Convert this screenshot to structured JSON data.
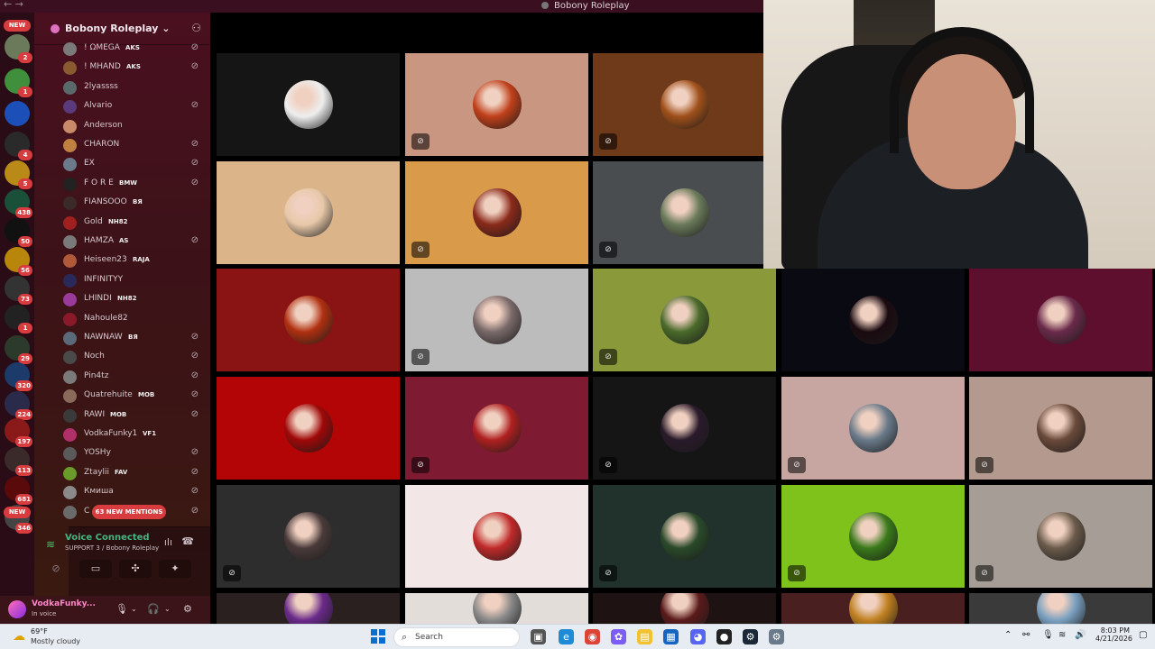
{
  "window": {
    "title": "Bobony Roleplay",
    "nav_label": "← →"
  },
  "rail": {
    "new_label_top": "NEW",
    "new_label_bottom": "NEW",
    "servers": [
      {
        "color": "#6a7a5a",
        "badge": "2"
      },
      {
        "color": "#3f8f3c",
        "badge": "1"
      },
      {
        "color": "#1d4fb8",
        "badge": ""
      },
      {
        "color": "#2a2a2a",
        "badge": "4"
      },
      {
        "color": "#b98a18",
        "badge": "5"
      },
      {
        "color": "#1a4f3a",
        "badge": "438"
      },
      {
        "color": "#111111",
        "badge": "50"
      },
      {
        "color": "#b8860b",
        "badge": "56"
      },
      {
        "color": "#333333",
        "badge": "73"
      },
      {
        "color": "#222222",
        "badge": "1"
      },
      {
        "color": "#2c3a2c",
        "badge": "29"
      },
      {
        "color": "#1c3a6a",
        "badge": "320"
      },
      {
        "color": "#2a2a4a",
        "badge": "224"
      },
      {
        "color": "#8a1a1a",
        "badge": "197"
      },
      {
        "color": "#3a2a2a",
        "badge": "113"
      },
      {
        "color": "#5a0a0a",
        "badge": "681"
      },
      {
        "color": "#444444",
        "badge": "346"
      }
    ]
  },
  "sidebar": {
    "server_name": "Bobony Roleplay",
    "server_caret": "⌄",
    "invite_icon": "add-person-icon",
    "members": [
      {
        "name": "! ΩMEGA",
        "tag": "AKS",
        "color": "#7a7a7a",
        "muted": true
      },
      {
        "name": "! MHAND",
        "tag": "AKS",
        "color": "#8a5a30",
        "muted": true
      },
      {
        "name": "2lyassss",
        "tag": "",
        "color": "#5a6a6a",
        "muted": false
      },
      {
        "name": "Alvario",
        "tag": "",
        "color": "#5a3a7a",
        "muted": true
      },
      {
        "name": "Anderson",
        "tag": "",
        "color": "#c98a6a",
        "muted": false
      },
      {
        "name": "CHARON",
        "tag": "",
        "color": "#c08040",
        "muted": true
      },
      {
        "name": "EX",
        "tag": "",
        "color": "#6a7a8a",
        "muted": true
      },
      {
        "name": "F O R E",
        "tag": "BMW",
        "color": "#222222",
        "muted": true
      },
      {
        "name": "FIANSOOO",
        "tag": "BЯ",
        "color": "#3a2a2a",
        "muted": false
      },
      {
        "name": "Gold",
        "tag": "NH82",
        "color": "#a02020",
        "muted": false
      },
      {
        "name": "HAMZA",
        "tag": "AS",
        "color": "#7a7a7a",
        "muted": true
      },
      {
        "name": "Heiseen23",
        "tag": "RAJA",
        "color": "#b05a3a",
        "muted": false
      },
      {
        "name": "INFINITYY",
        "tag": "",
        "color": "#2a2a5a",
        "muted": false
      },
      {
        "name": "LHINDI",
        "tag": "NH82",
        "color": "#9a3a9a",
        "muted": false
      },
      {
        "name": "Nahoule82",
        "tag": "",
        "color": "#8a1a2a",
        "muted": false
      },
      {
        "name": "NAWNAW",
        "tag": "BЯ",
        "color": "#5a6a7a",
        "muted": true
      },
      {
        "name": "Noch",
        "tag": "",
        "color": "#4a4a4a",
        "muted": true
      },
      {
        "name": "Pin4tz",
        "tag": "",
        "color": "#7a7a7a",
        "muted": true
      },
      {
        "name": "Quatrehuite",
        "tag": "MOB",
        "color": "#8a6a5a",
        "muted": true
      },
      {
        "name": "RAWI",
        "tag": "MOB",
        "color": "#3a3a3a",
        "muted": true
      },
      {
        "name": "VodkaFunky1",
        "tag": "VF1",
        "color": "#b0306a",
        "muted": false
      },
      {
        "name": "YOSHy",
        "tag": "",
        "color": "#5a5a5a",
        "muted": true
      },
      {
        "name": "Ztaylii",
        "tag": "FAV",
        "color": "#6a9a2a",
        "muted": true
      },
      {
        "name": "Кмиша",
        "tag": "",
        "color": "#8a8a8a",
        "muted": true
      },
      {
        "name": "C",
        "tag": "",
        "color": "#6a6a6a",
        "muted": true
      }
    ],
    "mentions_label": "63 NEW MENTIONS",
    "voice": {
      "status": "Voice Connected",
      "channel": "SUPPORT 3 / Bobony Roleplay"
    },
    "user": {
      "name": "VodkaFunky...",
      "status": "In voice"
    }
  },
  "grid": {
    "tiles": [
      {
        "bg": "#151515",
        "pic": "#eeeeee",
        "muted": false
      },
      {
        "bg": "#c99682",
        "pic": "#c0401a",
        "muted": true
      },
      {
        "bg": "#6e3a1a",
        "pic": "#a0501a",
        "muted": true
      },
      {
        "bg": "#dcb48a",
        "pic": "#e8c8a8",
        "muted": false
      },
      {
        "bg": "#d99b4a",
        "pic": "#8a2a1a",
        "muted": true
      },
      {
        "bg": "#4a4d50",
        "pic": "#6a7a5a",
        "muted": true
      },
      {
        "bg": "#8a1414",
        "pic": "#b03010",
        "muted": false
      },
      {
        "bg": "#bdbcbc",
        "pic": "#7a6a6a",
        "muted": true
      },
      {
        "bg": "#8a9a3a",
        "pic": "#4a6a2a",
        "muted": true
      },
      {
        "bg": "#0a0a12",
        "pic": "#1a0a10",
        "muted": false
      },
      {
        "bg": "#5e0f2e",
        "pic": "#6a2a4a",
        "muted": false
      },
      {
        "bg": "#b30505",
        "pic": "#a00808",
        "muted": false
      },
      {
        "bg": "#7e1b33",
        "pic": "#b02020",
        "muted": true
      },
      {
        "bg": "#151515",
        "pic": "#2a1a2a",
        "muted": true
      },
      {
        "bg": "#c7a5a0",
        "pic": "#6a7a8a",
        "muted": true
      },
      {
        "bg": "#b4998f",
        "pic": "#6a4a3a",
        "muted": true
      },
      {
        "bg": "#2d2d2d",
        "pic": "#4a3a3a",
        "muted": true
      },
      {
        "bg": "#f2e6e6",
        "pic": "#c02a2a",
        "muted": false
      },
      {
        "bg": "#21312c",
        "pic": "#2a4a2a",
        "muted": true
      },
      {
        "bg": "#7fc21c",
        "pic": "#3a7a1a",
        "muted": true
      },
      {
        "bg": "#a69d96",
        "pic": "#6a5a4a",
        "muted": true
      },
      {
        "bg": "#2a2020",
        "pic": "#6a2a8a",
        "muted": false
      },
      {
        "bg": "#e3ddda",
        "pic": "#888888",
        "muted": false
      },
      {
        "bg": "#1e1212",
        "pic": "#5a1a1a",
        "muted": false
      },
      {
        "bg": "#4a1f1f",
        "pic": "#c08020",
        "muted": false
      },
      {
        "bg": "#3a3a3a",
        "pic": "#7aa0c0",
        "muted": false
      }
    ]
  },
  "taskbar": {
    "temperature": "69°F",
    "weather": "Mostly cloudy",
    "search_label": "Search",
    "time": "8:03 PM",
    "date": "4/21/2026"
  },
  "colors": {
    "accent": "#d83c3e",
    "voice_green": "#43b581",
    "brand": "#4a1020"
  }
}
